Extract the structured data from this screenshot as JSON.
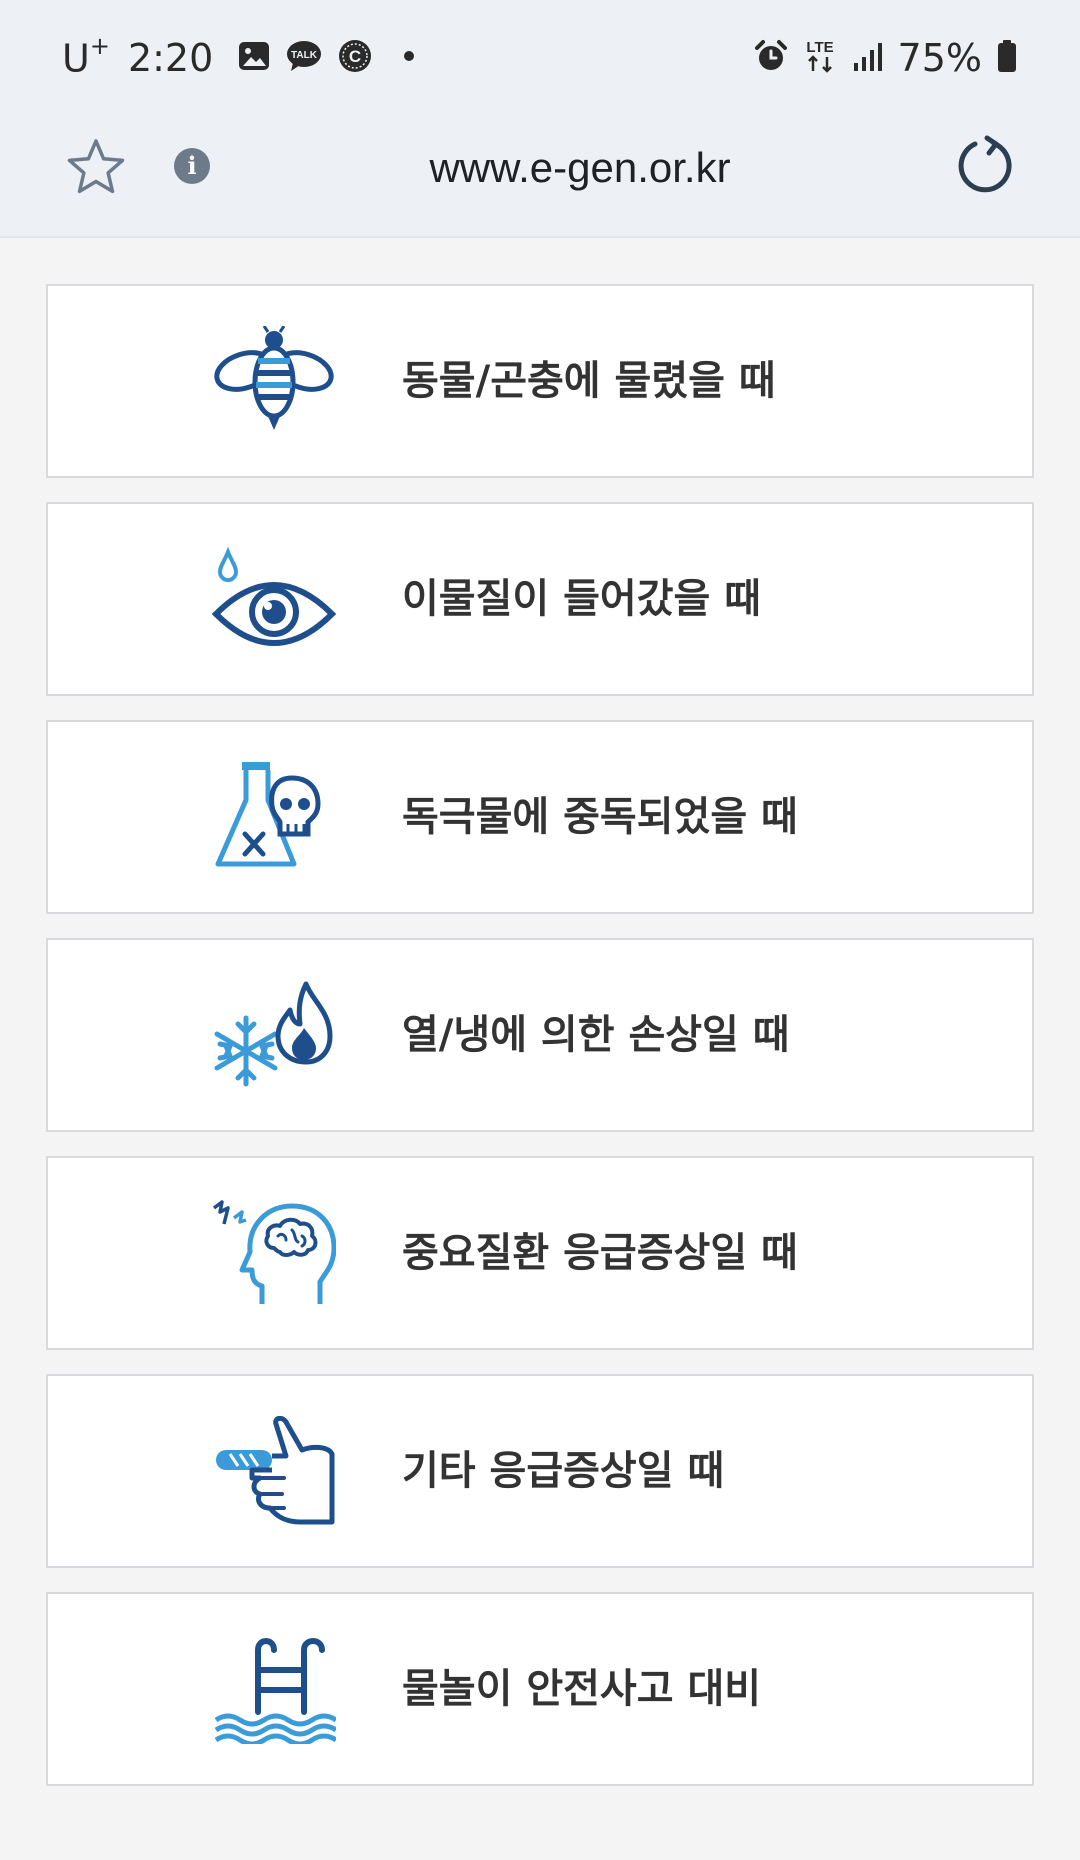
{
  "status_bar": {
    "carrier": "U",
    "carrier_sup": "+",
    "time": "2:20",
    "network": "LTE",
    "battery": "75%",
    "notification_icons": [
      "gallery-icon",
      "kakaotalk-icon",
      "c-icon",
      "dot-icon"
    ],
    "system_icons": [
      "alarm-icon",
      "lte-icon",
      "signal-icon",
      "battery-icon"
    ]
  },
  "browser": {
    "url": "www.e-gen.or.kr",
    "info_glyph": "i"
  },
  "colors": {
    "icon_dark": "#1e4f8c",
    "icon_light": "#3b9bd8",
    "label": "#333333"
  },
  "menu": {
    "items": [
      {
        "label": "동물/곤충에 물렸을 때",
        "icon": "bee-icon"
      },
      {
        "label": "이물질이 들어갔을 때",
        "icon": "eye-drop-icon"
      },
      {
        "label": "독극물에 중독되었을 때",
        "icon": "poison-flask-icon"
      },
      {
        "label": "열/냉에 의한 손상일 때",
        "icon": "snowflake-fire-icon"
      },
      {
        "label": "중요질환 응급증상일 때",
        "icon": "brain-head-icon"
      },
      {
        "label": "기타 응급증상일 때",
        "icon": "bandaged-hand-icon"
      },
      {
        "label": "물놀이 안전사고 대비",
        "icon": "pool-ladder-icon"
      }
    ]
  }
}
